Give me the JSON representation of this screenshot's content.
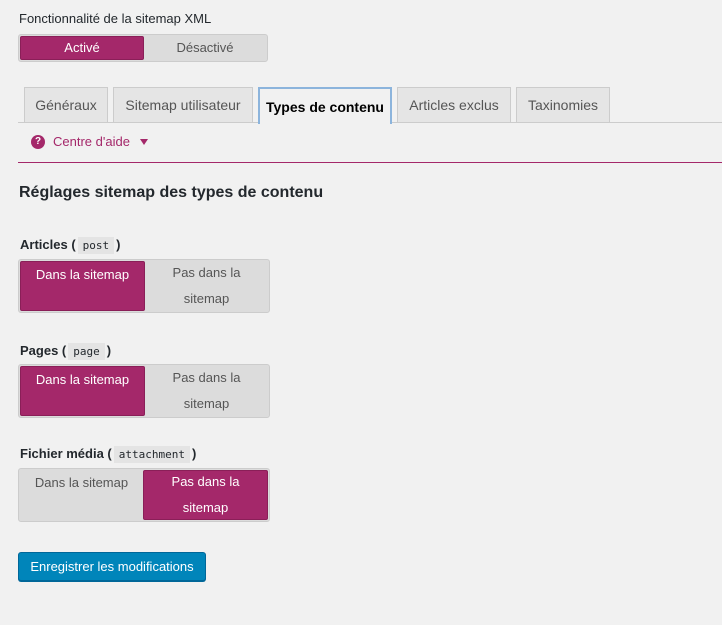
{
  "feature": {
    "label": "Fonctionnalité de la sitemap XML",
    "on_label": "Activé",
    "off_label": "Désactivé",
    "selected": "on"
  },
  "tabs": [
    {
      "label": "Généraux"
    },
    {
      "label": "Sitemap utilisateur"
    },
    {
      "label": "Types de contenu"
    },
    {
      "label": "Articles exclus"
    },
    {
      "label": "Taxinomies"
    }
  ],
  "active_tab": "Types de contenu",
  "help": {
    "label": "Centre d'aide"
  },
  "section_title": "Réglages sitemap des types de contenu",
  "content_types": [
    {
      "name": "Articles",
      "slug": "post",
      "in_label": "Dans la sitemap",
      "out_label": "Pas dans la sitemap",
      "selected": "in"
    },
    {
      "name": "Pages",
      "slug": "page",
      "in_label": "Dans la sitemap",
      "out_label": "Pas dans la sitemap",
      "selected": "in"
    },
    {
      "name": "Fichier média",
      "slug": "attachment",
      "in_label": "Dans la sitemap",
      "out_label": "Pas dans la sitemap",
      "selected": "out"
    }
  ],
  "save_label": "Enregistrer les modifications",
  "colors": {
    "accent": "#a4286a",
    "primary_button": "#0085ba",
    "active_tab_border": "#8cb4dc"
  }
}
